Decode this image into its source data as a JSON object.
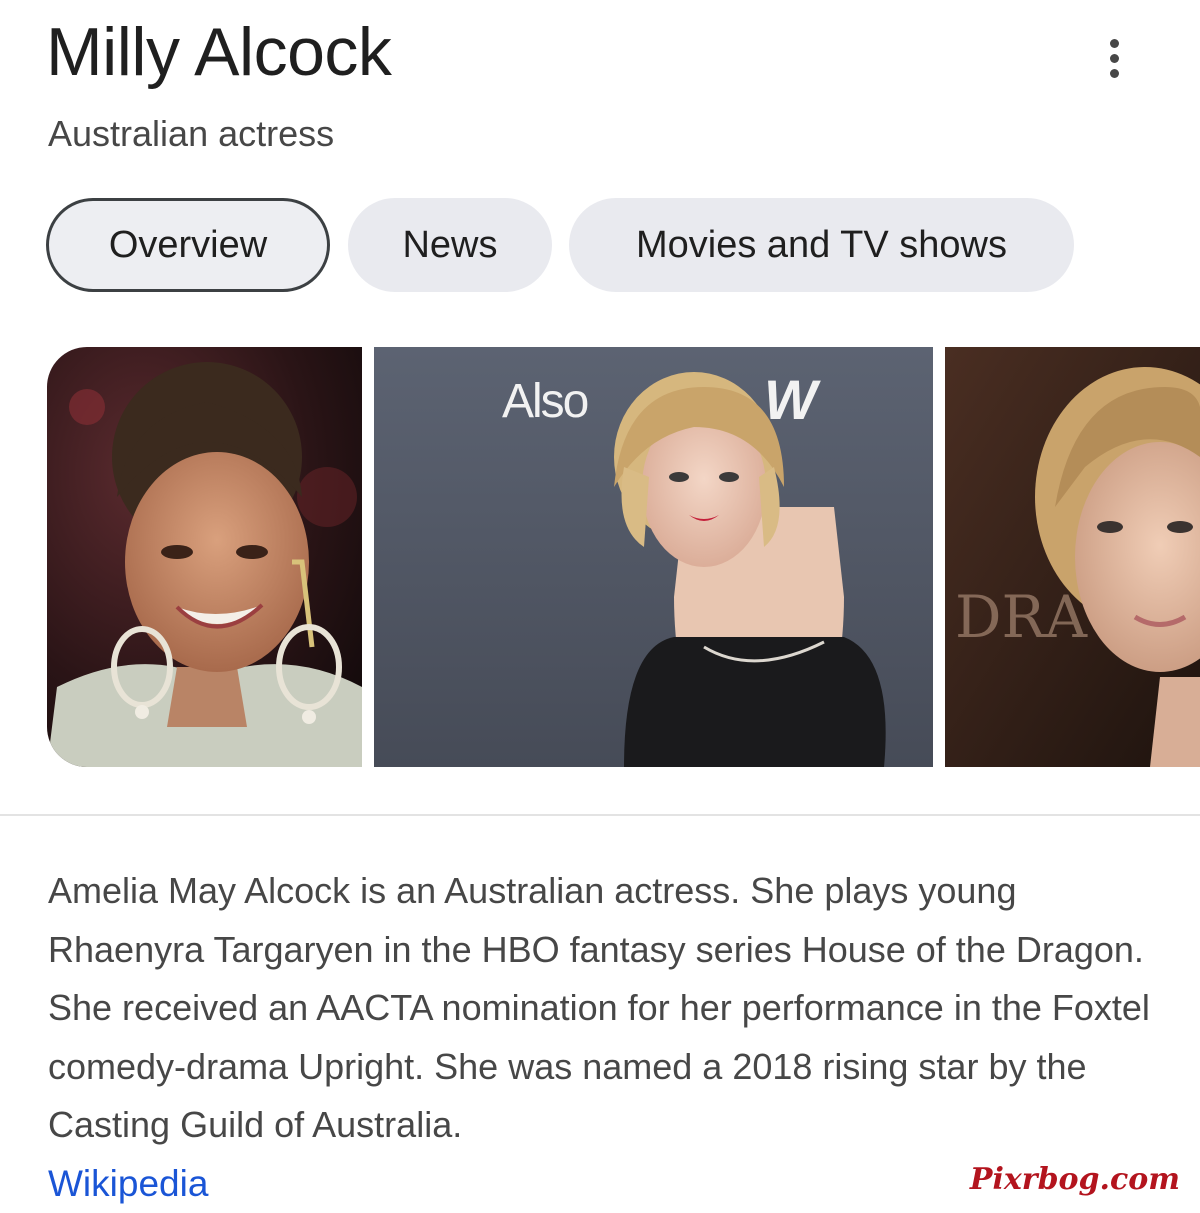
{
  "header": {
    "title": "Milly Alcock",
    "subtitle": "Australian actress",
    "more_icon": "more-vertical-icon"
  },
  "tabs": [
    {
      "label": "Overview",
      "active": true
    },
    {
      "label": "News",
      "active": false
    },
    {
      "label": "Movies and TV shows",
      "active": false
    }
  ],
  "gallery": {
    "images": [
      {
        "subject": "portrait-earrings"
      },
      {
        "subject": "red-carpet-black-dress",
        "backdrop_text": "Also on NOW"
      },
      {
        "subject": "portrait-premiere"
      }
    ]
  },
  "description": {
    "text": "Amelia May Alcock is an Australian actress. She plays young Rhaenyra Targaryen in the HBO fantasy series House of the Dragon. She received an AACTA nomination for her performance in the Foxtel comedy-drama Upright. She was named a 2018 rising star by the Casting Guild of Australia.",
    "source_label": "Wikipedia"
  },
  "watermark": "Pixrbog.com",
  "colors": {
    "title": "#1f1f1f",
    "text": "#474747",
    "chip_bg": "#e9eaef",
    "link": "#1a55d6",
    "watermark": "#b3141e"
  }
}
